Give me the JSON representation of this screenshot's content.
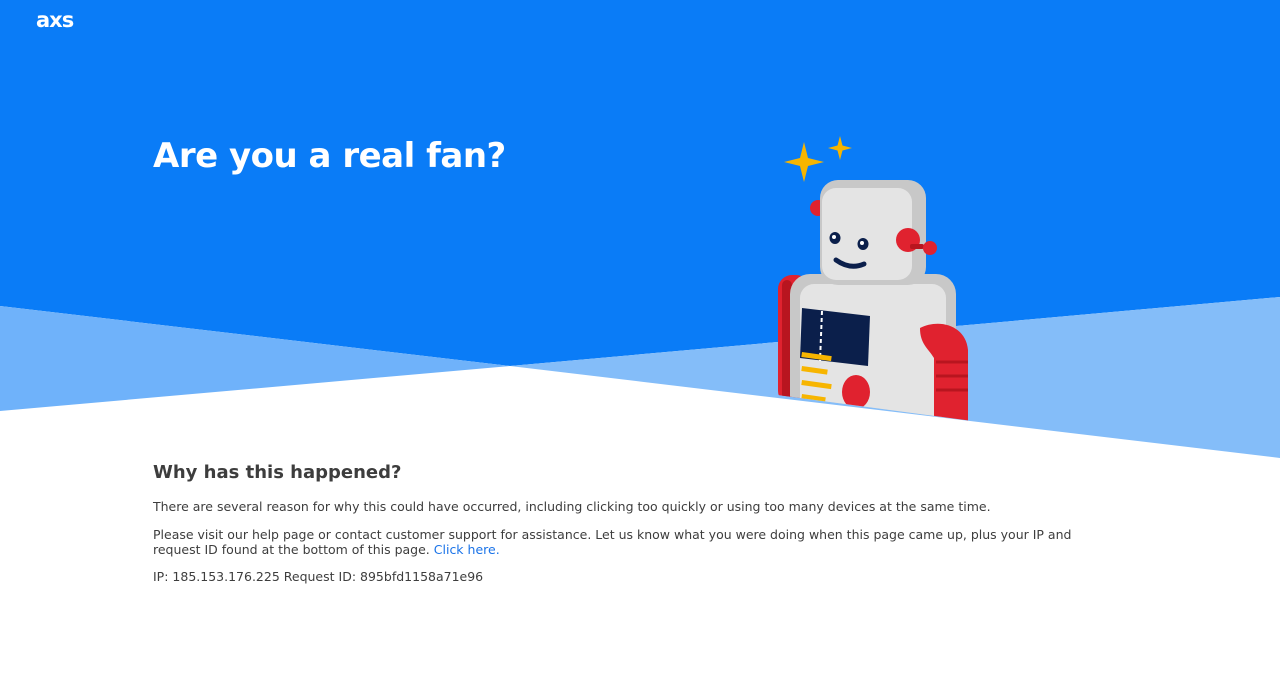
{
  "header": {
    "logo_text": "axs"
  },
  "hero": {
    "headline": "Are you a real fan?"
  },
  "info": {
    "heading": "Why has this happened?",
    "paragraph_1": "There are several reason for why this could have occurred, including clicking too quickly or using too many devices at the same time.",
    "paragraph_2": "Please visit our help page or contact customer support for assistance. Let us know what you were doing when this page came up, plus your IP and request ID found at the bottom of this page.",
    "link_text": "Click here.",
    "ip_label": "IP:",
    "ip_value": "185.153.176.225",
    "request_label": "Request ID:",
    "request_value": "895bfd1158a71e96"
  },
  "icons": {
    "logo": "axs-logo",
    "illustration": "robot-illustration",
    "sparkles": "sparkle-icon"
  },
  "colors": {
    "primary_blue": "#0a7cf7",
    "light_blue": "#84bdf9",
    "mid_blue": "#4b9ef8",
    "link_blue": "#1a73e8",
    "robot_gray": "#c8c8c8",
    "robot_red": "#e0222f",
    "sparkle_yellow": "#f7b500",
    "ticket_navy": "#0b1f4b"
  }
}
